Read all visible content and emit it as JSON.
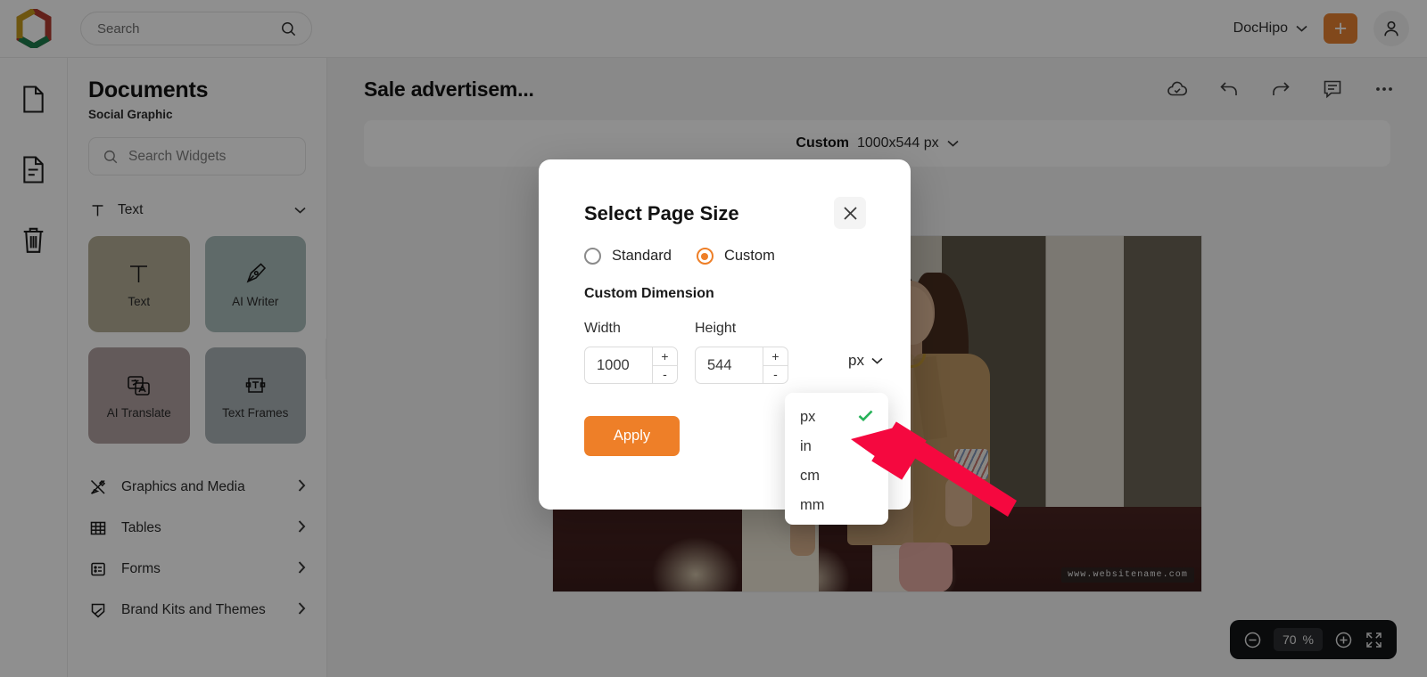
{
  "colors": {
    "accent": "#ee7f28",
    "accent_plus": "#c8711f",
    "check_green": "#27b259",
    "arrow_red": "#f5083f"
  },
  "topbar": {
    "logo_name": "dochipo-logo",
    "search_placeholder": "Search",
    "brand_label": "DocHipo",
    "plus_label": "+"
  },
  "rail": {
    "items": [
      {
        "name": "documents",
        "icon": "page-icon"
      },
      {
        "name": "pages",
        "icon": "page-lines-icon"
      },
      {
        "name": "trash",
        "icon": "trash-icon"
      }
    ]
  },
  "panel": {
    "title": "Documents",
    "subtitle": "Social Graphic",
    "search_placeholder": "Search Widgets",
    "section": {
      "label": "Text",
      "icon": "text-t-icon"
    },
    "cards": [
      {
        "label": "Text",
        "icon": "text-t-icon",
        "bg": "#b4ae94"
      },
      {
        "label": "AI Writer",
        "icon": "pen-nib-icon",
        "bg": "#a9bdbb"
      },
      {
        "label": "AI Translate",
        "icon": "translate-icon",
        "bg": "#b2a0a0"
      },
      {
        "label": "Text Frames",
        "icon": "text-frame-icon",
        "bg": "#a9b2b6"
      }
    ],
    "list": [
      {
        "label": "Graphics and Media",
        "icon": "graphics-media-icon"
      },
      {
        "label": "Tables",
        "icon": "table-grid-icon"
      },
      {
        "label": "Forms",
        "icon": "form-icon"
      },
      {
        "label": "Brand Kits and Themes",
        "icon": "brand-kit-icon"
      }
    ]
  },
  "editor": {
    "doc_title": "Sale advertisem...",
    "tools": [
      {
        "name": "cloud-saved-icon"
      },
      {
        "name": "undo-icon"
      },
      {
        "name": "redo-icon"
      },
      {
        "name": "comment-icon"
      },
      {
        "name": "more-options-icon"
      }
    ],
    "size_bar": {
      "mode": "Custom",
      "value": "1000x544 px"
    },
    "canvas": {
      "watermark": "www.websitename.com"
    },
    "zoom": {
      "value": "70",
      "unit": "%",
      "minus": "−",
      "plus": "+"
    }
  },
  "modal": {
    "title": "Select Page Size",
    "close_label": "×",
    "options": [
      {
        "label": "Standard",
        "selected": false
      },
      {
        "label": "Custom",
        "selected": true
      }
    ],
    "custom_dimension_label": "Custom Dimension",
    "width": {
      "label": "Width",
      "value": "1000",
      "inc": "+",
      "dec": "-"
    },
    "height": {
      "label": "Height",
      "value": "544",
      "inc": "+",
      "dec": "-"
    },
    "unit": {
      "selected": "px"
    },
    "apply_label": "Apply"
  },
  "unit_menu": {
    "options": [
      {
        "label": "px",
        "checked": true
      },
      {
        "label": "in",
        "checked": false
      },
      {
        "label": "cm",
        "checked": false
      },
      {
        "label": "mm",
        "checked": false
      }
    ]
  }
}
